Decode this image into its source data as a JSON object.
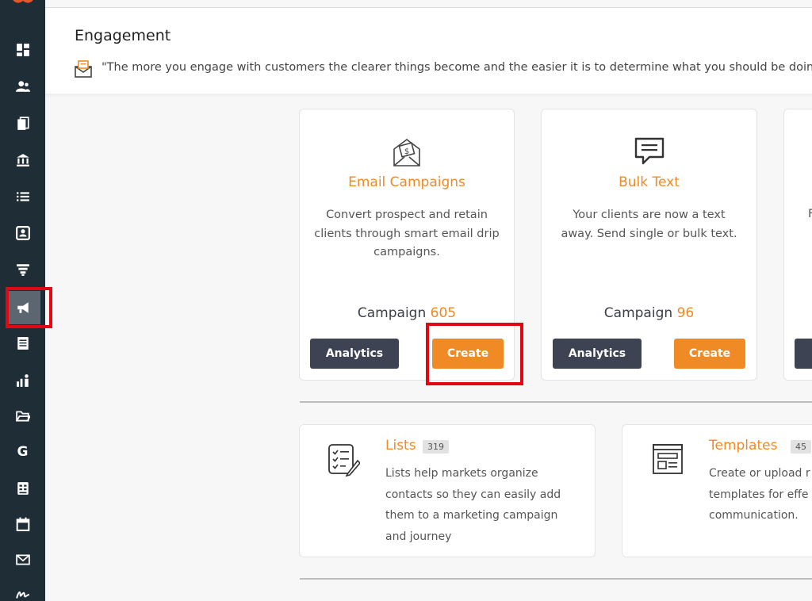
{
  "header": {
    "title": "Engagement",
    "quote": "\"The more you engage with customers the clearer things become and the easier it is to determine what you should be doing"
  },
  "sidebar": {
    "items": [
      {
        "icon": "dashboard-icon"
      },
      {
        "icon": "contacts-icon"
      },
      {
        "icon": "documents-icon"
      },
      {
        "icon": "bank-icon"
      },
      {
        "icon": "list-icon"
      },
      {
        "icon": "contact-card-icon"
      },
      {
        "icon": "funnel-icon"
      },
      {
        "icon": "megaphone-icon",
        "active": true
      },
      {
        "icon": "notes-icon"
      },
      {
        "icon": "reports-icon"
      },
      {
        "icon": "folder-icon"
      },
      {
        "icon": "google-icon"
      },
      {
        "icon": "spreadsheet-icon"
      },
      {
        "icon": "calendar-icon"
      },
      {
        "icon": "mail-icon"
      },
      {
        "icon": "signature-icon"
      }
    ],
    "google_letter": "G"
  },
  "cards": {
    "email": {
      "title": "Email Campaigns",
      "desc": "Convert prospect and retain clients through smart email drip campaigns.",
      "count_label": "Campaign",
      "count": "605",
      "analytics": "Analytics",
      "create": "Create"
    },
    "text": {
      "title": "Bulk Text",
      "desc": "Your clients are now a text away. Send single or bulk text.",
      "count_label": "Campaign",
      "count": "96",
      "analytics": "Analytics",
      "create": "Create"
    },
    "third_fragment": "F"
  },
  "lists": {
    "title": "Lists",
    "badge": "319",
    "desc": "Lists help markets organize contacts so they can easily add them to a marketing campaign and journey"
  },
  "templates": {
    "title": "Templates",
    "badge": "45",
    "desc": "Create or upload r templates for effe communication."
  },
  "colors": {
    "sidebar": "#1f2d37",
    "accent": "#f08a24",
    "dark_button": "#3d4352",
    "highlight": "#e30613"
  }
}
